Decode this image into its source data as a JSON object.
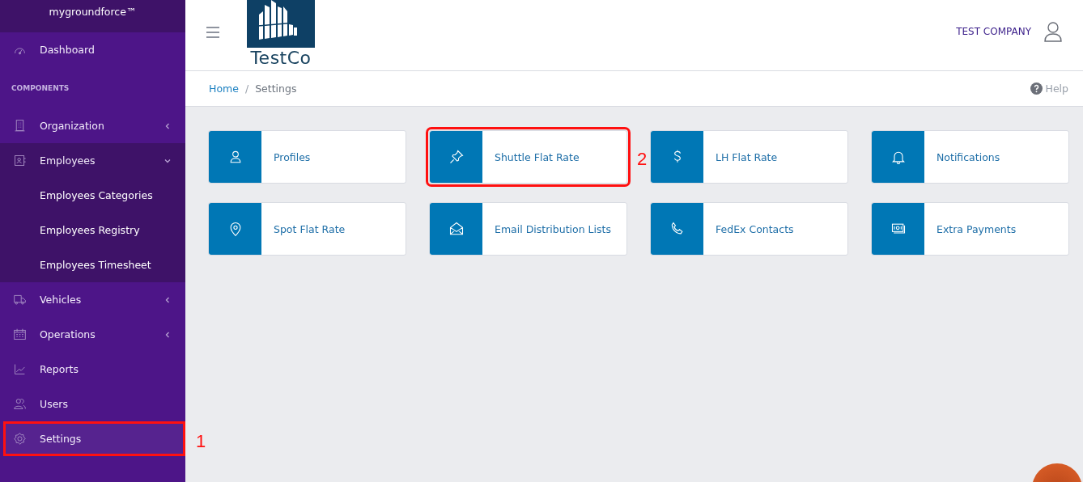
{
  "sidebar": {
    "brand": "mygroundforce™",
    "items": [
      {
        "kind": "item",
        "label": "Dashboard",
        "selected": false
      },
      {
        "kind": "header",
        "label": "COMPONENTS"
      },
      {
        "kind": "item",
        "label": "Organization",
        "selected": false,
        "expanded": false
      },
      {
        "kind": "item",
        "label": "Employees",
        "selected": false,
        "expanded": true,
        "children": [
          {
            "label": "Employees Categories"
          },
          {
            "label": "Employees Registry"
          },
          {
            "label": "Employees Timesheet"
          }
        ]
      },
      {
        "kind": "item",
        "label": "Vehicles",
        "selected": false,
        "expanded": false
      },
      {
        "kind": "item",
        "label": "Operations",
        "selected": false,
        "expanded": false
      },
      {
        "kind": "item",
        "label": "Reports",
        "selected": false
      },
      {
        "kind": "item",
        "label": "Users",
        "selected": false
      },
      {
        "kind": "item",
        "label": "Settings",
        "selected": true,
        "annotation": "1"
      }
    ]
  },
  "header": {
    "logo_text": "TestCo",
    "company": "TEST COMPANY"
  },
  "breadcrumb": {
    "items": [
      "Home",
      "Settings"
    ],
    "separator": "/",
    "help": "Help"
  },
  "cards": [
    {
      "label": "Profiles"
    },
    {
      "label": "Shuttle Flat Rate",
      "annotation": "2"
    },
    {
      "label": "LH Flat Rate"
    },
    {
      "label": "Notifications"
    },
    {
      "label": "Spot Flat Rate"
    },
    {
      "label": "Email Distribution Lists"
    },
    {
      "label": "FedEx Contacts"
    },
    {
      "label": "Extra Payments"
    }
  ]
}
